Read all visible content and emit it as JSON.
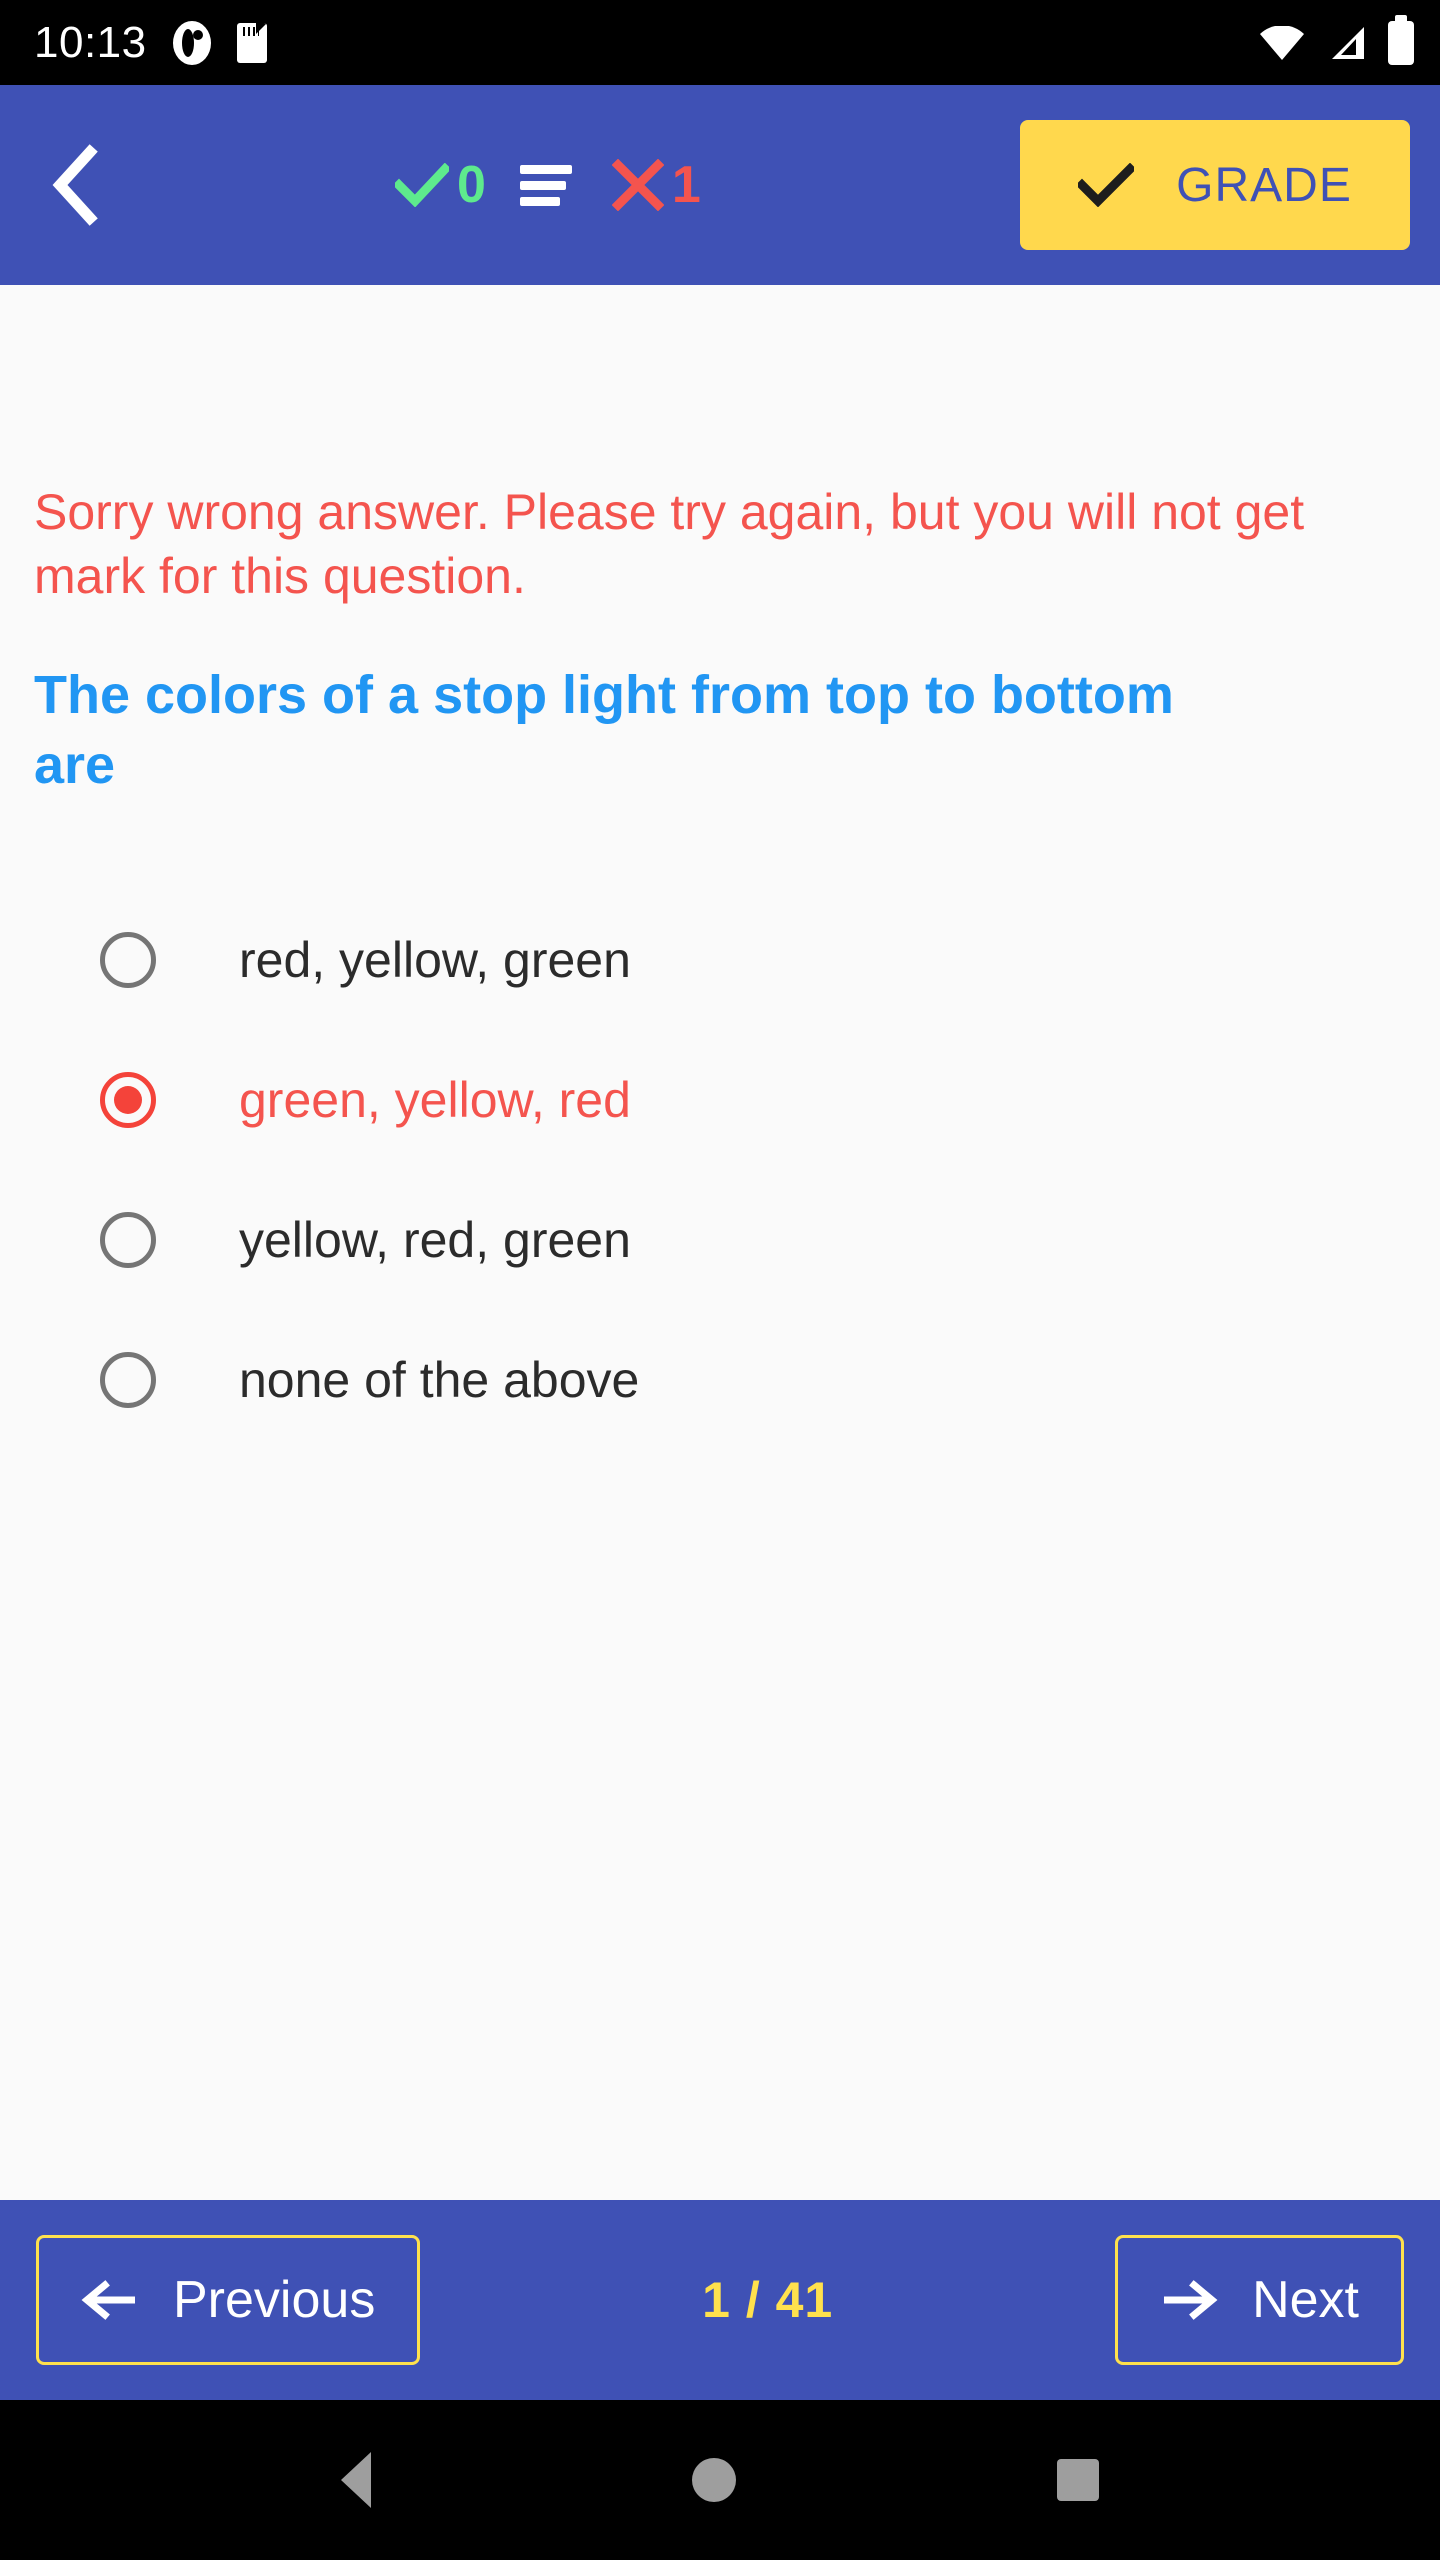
{
  "status_bar": {
    "time": "10:13",
    "icons_left": [
      "face-icon",
      "sd-card-icon"
    ],
    "icons_right": [
      "wifi-icon",
      "cellular-signal-icon",
      "battery-icon"
    ]
  },
  "app_bar": {
    "back_icon": "back-chevron-icon",
    "correct_icon": "check-icon",
    "correct_count": "0",
    "list_icon": "list-icon",
    "wrong_icon": "x-icon",
    "wrong_count": "1",
    "grade_button": {
      "label": "GRADE",
      "icon": "check-icon"
    },
    "background_color": "#3f51b5",
    "grade_bg_color": "#ffd84d",
    "grade_text_color": "#3f51b5"
  },
  "main": {
    "feedback": "Sorry wrong answer. Please try again, but you will not get mark for this question.",
    "feedback_color": "#f4544e",
    "question": "The colors of a stop light from top to bottom are",
    "question_color": "#2196f3",
    "options": [
      {
        "label": "red, yellow, green",
        "selected": false
      },
      {
        "label": "green, yellow, red",
        "selected": true
      },
      {
        "label": "yellow, red, green",
        "selected": false
      },
      {
        "label": "none of the above",
        "selected": false
      }
    ],
    "selected_color": "#f4433a",
    "unselected_color": "#757575"
  },
  "bottom_bar": {
    "previous_label": "Previous",
    "previous_icon": "arrow-left-icon",
    "next_label": "Next",
    "next_icon": "arrow-right-icon",
    "page_counter": "1 / 41",
    "counter_color": "#ffe14d",
    "border_color": "#ffe14d"
  },
  "android_nav": {
    "back": "back-triangle-icon",
    "home": "home-circle-icon",
    "recents": "recents-square-icon"
  }
}
